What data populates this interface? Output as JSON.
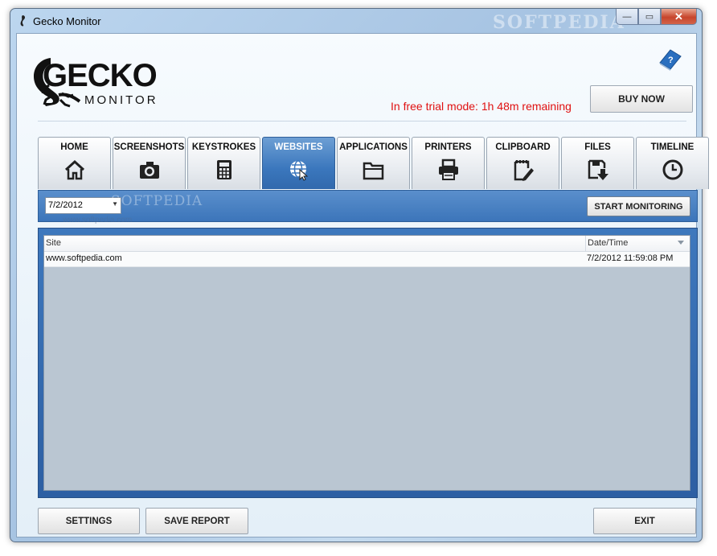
{
  "window": {
    "title": "Gecko Monitor",
    "watermark": "SOFTPEDIA",
    "controls": {
      "minimize": "—",
      "maximize": "▭",
      "close": "✕"
    }
  },
  "logo": {
    "word1": "GECKO",
    "word2": "MONITOR"
  },
  "header": {
    "buy_label": "BUY NOW",
    "trial_text": "In free trial mode: 1h 48m remaining",
    "trial_color": "#e01010"
  },
  "tabs": [
    {
      "label": "HOME",
      "icon": "home-icon"
    },
    {
      "label": "SCREENSHOTS",
      "icon": "camera-icon"
    },
    {
      "label": "KEYSTROKES",
      "icon": "calculator-icon"
    },
    {
      "label": "WEBSITES",
      "icon": "globe-cursor-icon",
      "active": true
    },
    {
      "label": "APPLICATIONS",
      "icon": "folder-icon"
    },
    {
      "label": "PRINTERS",
      "icon": "printer-icon"
    },
    {
      "label": "CLIPBOARD",
      "icon": "clipboard-pen-icon"
    },
    {
      "label": "FILES",
      "icon": "save-arrow-icon"
    },
    {
      "label": "TIMELINE",
      "icon": "clock-icon"
    }
  ],
  "toolbar": {
    "date_value": "7/2/2012",
    "start_label": "START MONITORING",
    "watermark": "SOFTPEDIA",
    "watermark_url": "www.softpedia.com"
  },
  "grid": {
    "columns": [
      "Site",
      "Date/Time"
    ],
    "rows": [
      {
        "site": "www.softpedia.com",
        "date": "7/2/2012 11:59:08 PM"
      }
    ]
  },
  "footer": {
    "settings_label": "SETTINGS",
    "save_report_label": "SAVE REPORT",
    "exit_label": "EXIT"
  },
  "colors": {
    "accent_blue": "#3b77bd",
    "panel_gray": "#bac6d2"
  }
}
